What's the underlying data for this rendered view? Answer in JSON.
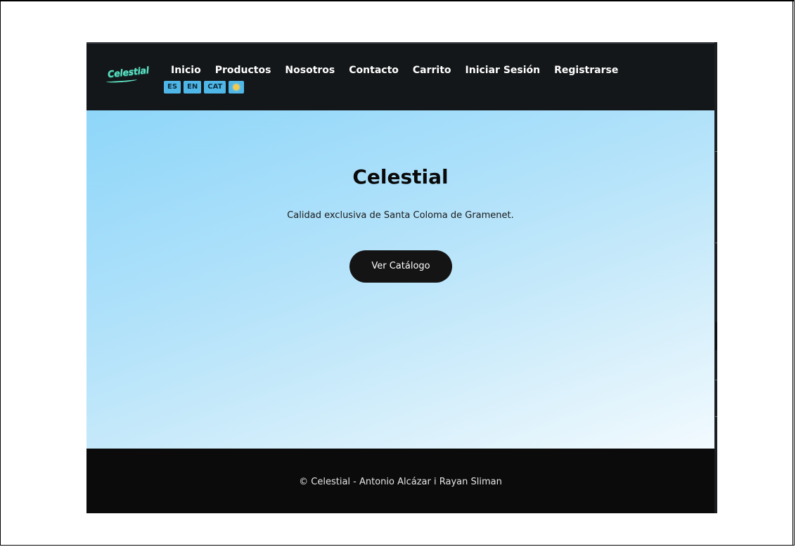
{
  "navbar": {
    "brand": "Celestial",
    "links": [
      "Inicio",
      "Productos",
      "Nosotros",
      "Contacto",
      "Carrito",
      "Iniciar Sesión",
      "Registrarse"
    ],
    "languages": [
      "ES",
      "EN",
      "CAT"
    ],
    "theme_toggle_icon": "sun-icon"
  },
  "hero": {
    "title": "Celestial",
    "subtitle": "Calidad exclusiva de Santa Coloma de Gramenet.",
    "cta_label": "Ver Catálogo"
  },
  "footer": {
    "text": "© Celestial - Antonio Alcázar i Rayan Sliman"
  },
  "colors": {
    "navbar_bg": "#141719",
    "accent": "#4fb7e8",
    "brand": "#5ee0c2",
    "hero_gradient_start": "#8ed6f9",
    "hero_gradient_end": "#f2fafe",
    "button_bg": "#141414",
    "footer_bg": "#0b0b0b"
  }
}
